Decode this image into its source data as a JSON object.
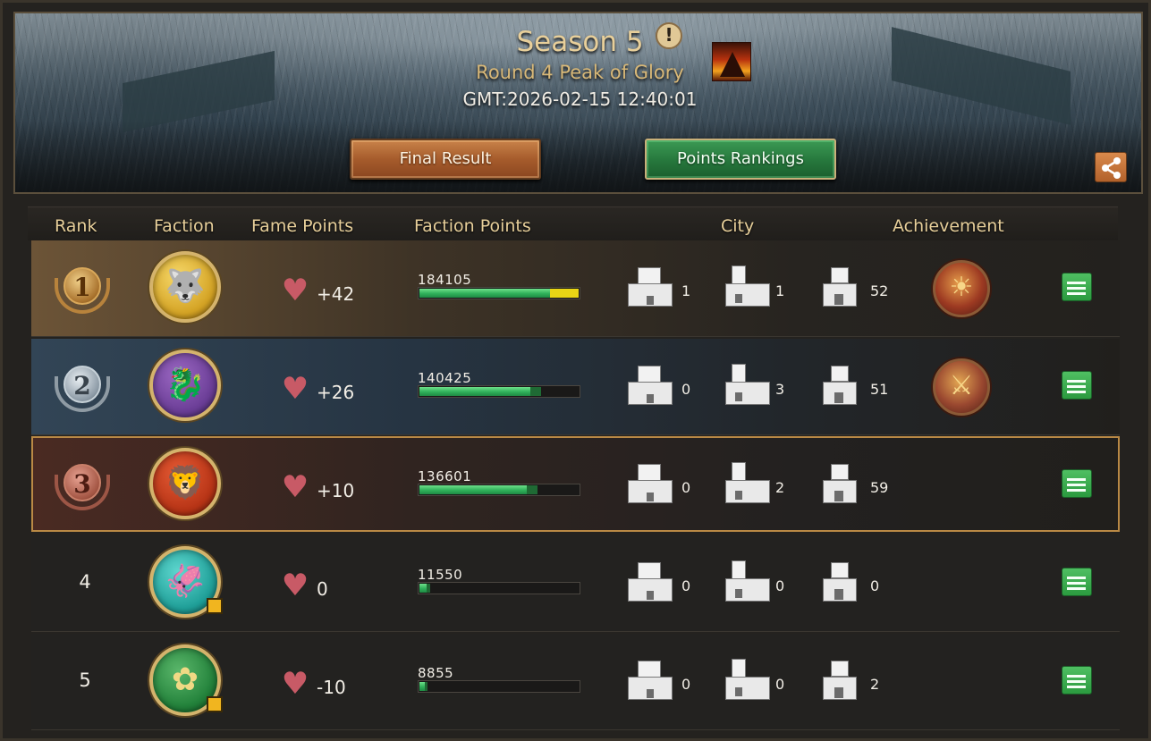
{
  "banner": {
    "title": "Season 5",
    "round": "Round 4 Peak of Glory",
    "gmt": "GMT:2026-02-15 12:40:01",
    "buttons": {
      "final_result": "Final Result",
      "points_rankings": "Points Rankings"
    }
  },
  "table": {
    "headers": {
      "rank": "Rank",
      "faction": "Faction",
      "fame_points": "Fame Points",
      "faction_points": "Faction Points",
      "city": "City",
      "achievement": "Achievement"
    },
    "rows": [
      {
        "rank": "1",
        "fame": "+42",
        "faction_points": "184105",
        "progress": 0.98,
        "city_large": "1",
        "city_medium": "1",
        "city_small": "52",
        "achievement": "sun-crest-badge"
      },
      {
        "rank": "2",
        "fame": "+26",
        "faction_points": "140425",
        "progress": 0.76,
        "city_large": "0",
        "city_medium": "3",
        "city_small": "51",
        "achievement": "sword-crest-badge"
      },
      {
        "rank": "3",
        "fame": "+10",
        "faction_points": "136601",
        "progress": 0.74,
        "city_large": "0",
        "city_medium": "2",
        "city_small": "59",
        "achievement": ""
      },
      {
        "rank": "4",
        "fame": "0",
        "faction_points": "11550",
        "progress": 0.07,
        "city_large": "0",
        "city_medium": "0",
        "city_small": "0",
        "achievement": ""
      },
      {
        "rank": "5",
        "fame": "-10",
        "faction_points": "8855",
        "progress": 0.05,
        "city_large": "0",
        "city_medium": "0",
        "city_small": "2",
        "achievement": ""
      }
    ],
    "factions": [
      "wolf-sigil",
      "dragon-sigil",
      "lion-sigil",
      "kraken-sigil",
      "rose-sigil"
    ]
  },
  "colors": {
    "accent_gold": "#e7cf9a",
    "progress_green": "#2fb05a",
    "progress_yellow": "#e9d515",
    "action_green": "#2b9a3f"
  }
}
